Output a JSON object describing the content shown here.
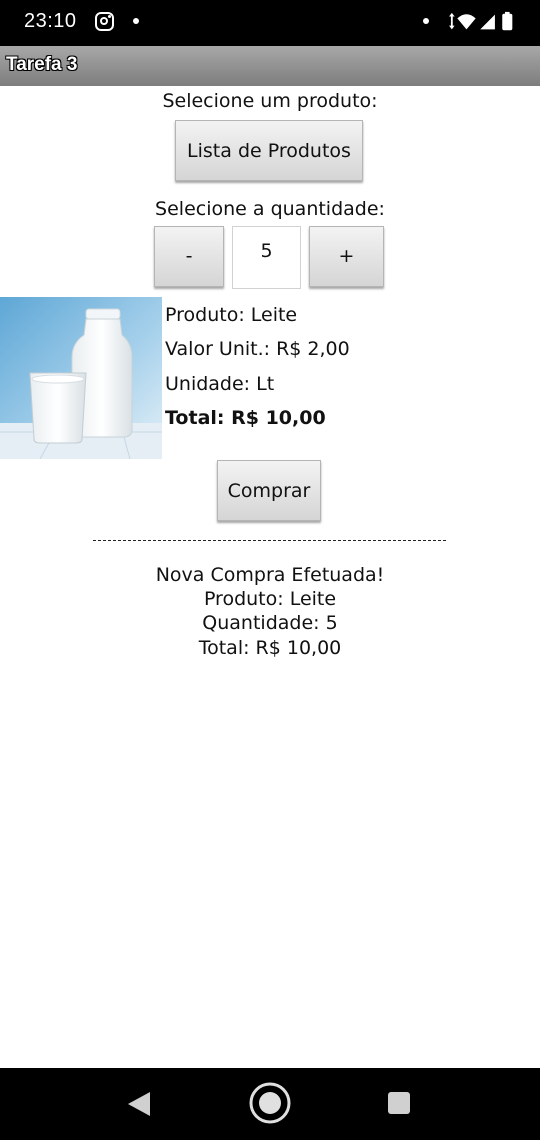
{
  "status_bar": {
    "time": "23:10",
    "icons": [
      "instagram-icon",
      "notification-dot-icon",
      "wifi-icon",
      "signal-icon",
      "battery-icon"
    ]
  },
  "title_bar": {
    "title": "Tarefa 3"
  },
  "product_select": {
    "label": "Selecione um produto:",
    "button_label": "Lista de Produtos"
  },
  "quantity": {
    "label": "Selecione a quantidade:",
    "minus_label": "-",
    "value": "5",
    "plus_label": "+"
  },
  "product": {
    "image": "milk-bottle-and-glass",
    "name_line": "Produto: Leite",
    "unit_price_line": "Valor Unit.: R$ 2,00",
    "unit_line": "Unidade: Lt",
    "total_line": "Total: R$ 10,00"
  },
  "buy_button_label": "Comprar",
  "separator_text": "------------------------------------------------------------",
  "summary": {
    "line1": "Nova Compra Efetuada!",
    "line2": "Produto: Leite",
    "line3": "Quantidade: 5",
    "line4": "Total: R$ 10,00"
  },
  "nav_bar": {
    "icons": [
      "back-icon",
      "home-icon",
      "recents-icon"
    ]
  },
  "colors": {
    "status_bar_bg": "#000000",
    "title_bar_bg": "#8f8f8f",
    "button_bg": "#e2e2e2"
  }
}
